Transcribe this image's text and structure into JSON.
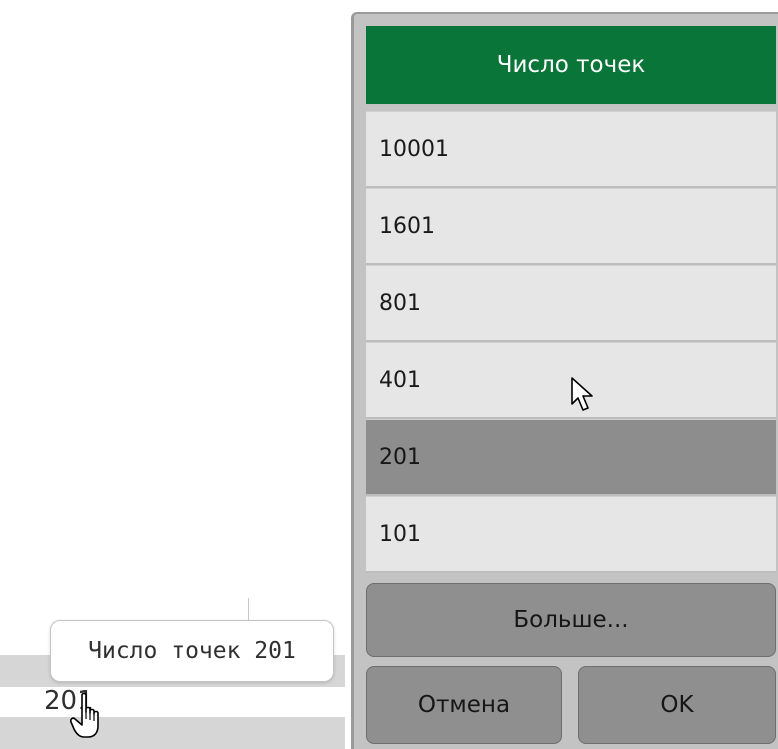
{
  "background": {
    "tooltip_text": "Число точек 201",
    "field_value": "201"
  },
  "dialog": {
    "title": "Число точек",
    "options": [
      {
        "label": "10001",
        "selected": false
      },
      {
        "label": "1601",
        "selected": false
      },
      {
        "label": "801",
        "selected": false
      },
      {
        "label": "401",
        "selected": false
      },
      {
        "label": "201",
        "selected": true
      },
      {
        "label": "101",
        "selected": false
      }
    ],
    "more_label": "Больше...",
    "cancel_label": "Отмена",
    "ok_label": "OK"
  },
  "colors": {
    "header_bg": "#0a7538",
    "header_text": "#ffffff",
    "item_bg": "#e6e6e6",
    "item_selected_bg": "#8d8d8d",
    "button_bg": "#8f8f8f",
    "dialog_bg": "#c3c3c3"
  },
  "icons": {
    "pointer": "hand-pointer-icon",
    "arrow": "arrow-cursor-icon"
  }
}
